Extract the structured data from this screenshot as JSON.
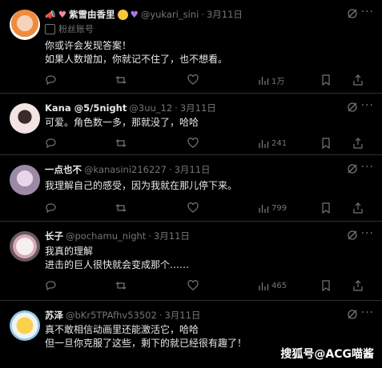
{
  "tweets": [
    {
      "name": "紫雪由香里",
      "handle": "@yukari_sini",
      "date": "3月11日",
      "badge": "粉丝账号",
      "text": [
        "你或许会发现答案！",
        "如果人数增加，你就记不住了，也不想看。"
      ],
      "views": "1万"
    },
    {
      "name": "Kana @5/5night",
      "handle": "@3uu_12",
      "date": "3月11日",
      "text": [
        "可爱。角色数一多，那就没了，哈哈"
      ],
      "views": "241"
    },
    {
      "name": "一点也不",
      "handle": "@kanasini216227",
      "date": "3月11日",
      "text": [
        "我理解自己的感受，因为我就在那儿停下来。"
      ],
      "views": "799"
    },
    {
      "name": "长子",
      "handle": "@pochamu_night",
      "date": "3月11日",
      "text": [
        "我真的理解",
        "进击的巨人很快就会变成那个……"
      ],
      "views": "465"
    },
    {
      "name": "苏泽",
      "handle": "@bKr5TPAfhv53502",
      "date": "3月11日",
      "text": [
        "真不敢相信动画里还能激活它，哈哈",
        "但一旦你克服了这些，剩下的就已经很有趣了！"
      ],
      "views": ""
    }
  ],
  "dot": "·",
  "more": "···",
  "watermark": "搜狐号@ACG喵酱",
  "colors": {
    "background": "#000000",
    "text": "#e7e9ea",
    "muted": "#71767b",
    "divider": "#2f3336"
  }
}
